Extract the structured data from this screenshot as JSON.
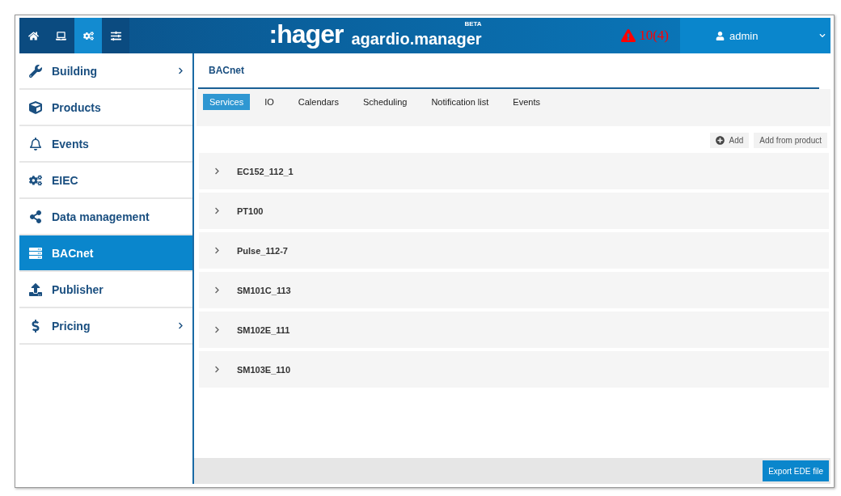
{
  "header": {
    "nav_buttons": [
      {
        "selected": false
      },
      {
        "selected": false
      },
      {
        "selected": true
      },
      {
        "selected": false
      }
    ],
    "logo": ":hager",
    "product": "agardio.manager",
    "badge": "BETA",
    "alerts": "10(4)",
    "user": "admin"
  },
  "sidebar": {
    "items": [
      {
        "label": "Building",
        "selected": false,
        "has_submenu": true
      },
      {
        "label": "Products",
        "selected": false,
        "has_submenu": false
      },
      {
        "label": "Events",
        "selected": false,
        "has_submenu": false
      },
      {
        "label": "EIEC",
        "selected": false,
        "has_submenu": false
      },
      {
        "label": "Data management",
        "selected": false,
        "has_submenu": false
      },
      {
        "label": "BACnet",
        "selected": true,
        "has_submenu": false
      },
      {
        "label": "Publisher",
        "selected": false,
        "has_submenu": false
      },
      {
        "label": "Pricing",
        "selected": false,
        "has_submenu": true
      }
    ]
  },
  "page": {
    "title": "BACnet",
    "tabs": [
      {
        "label": "Services",
        "selected": true
      },
      {
        "label": "IO",
        "selected": false
      },
      {
        "label": "Calendars",
        "selected": false
      },
      {
        "label": "Scheduling",
        "selected": false
      },
      {
        "label": "Notification list",
        "selected": false
      },
      {
        "label": "Events",
        "selected": false
      }
    ],
    "actions": [
      "Add",
      "Add from product"
    ],
    "services": [
      {
        "name": "EC152_112_1",
        "expanded": false
      },
      {
        "name": "PT100",
        "expanded": false
      },
      {
        "name": "Pulse_112-7",
        "expanded": false
      },
      {
        "name": "SM101C_113",
        "expanded": false
      },
      {
        "name": "SM102E_111",
        "expanded": false
      },
      {
        "name": "SM103E_110",
        "expanded": false
      }
    ],
    "footer_button": "Export EDE file"
  }
}
